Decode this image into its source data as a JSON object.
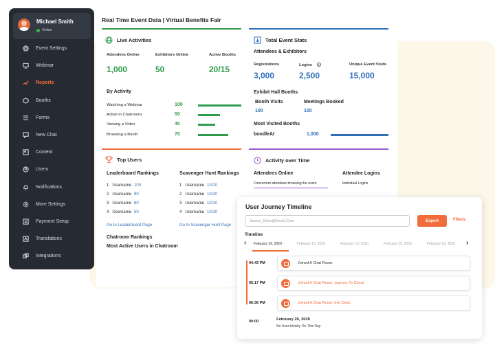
{
  "sidebar": {
    "user_name": "Michael Smith",
    "user_status": "Online",
    "items": [
      {
        "label": "Event Settings",
        "icon": "gear-icon"
      },
      {
        "label": "Webinar",
        "icon": "monitor-icon"
      },
      {
        "label": "Reports",
        "icon": "chart-icon"
      },
      {
        "label": "Booths",
        "icon": "booth-icon"
      },
      {
        "label": "Forms",
        "icon": "forms-icon"
      },
      {
        "label": "New Chat",
        "icon": "chat-icon"
      },
      {
        "label": "Content",
        "icon": "content-icon"
      },
      {
        "label": "Users",
        "icon": "users-icon"
      },
      {
        "label": "Notifications",
        "icon": "bell-icon"
      },
      {
        "label": "More Settings",
        "icon": "settings-icon"
      },
      {
        "label": "Payment Setup",
        "icon": "payment-icon"
      },
      {
        "label": "Translations",
        "icon": "translate-icon"
      },
      {
        "label": "Integrations",
        "icon": "integrations-icon"
      }
    ],
    "active_item": "Reports",
    "colors": {
      "bg": "#262b33",
      "active": "#f26b3a"
    }
  },
  "main": {
    "title": "Real Time Event Data | Virtual Benefits Fair",
    "live_activities": {
      "title": "Live Activities",
      "labels": [
        "Attendees Online",
        "Exhibitors Online",
        "Active Booths"
      ],
      "values": [
        "1,000",
        "50",
        "20/15"
      ]
    },
    "by_activity": {
      "title": "By Activity",
      "rows": [
        {
          "label": "Watching a Webinar",
          "value": "100",
          "level": 1.0
        },
        {
          "label": "Active in Chatrooms",
          "value": "50",
          "level": 0.5
        },
        {
          "label": "Viewing a Video",
          "value": "40",
          "level": 0.4
        },
        {
          "label": "Browsing a Booth",
          "value": "70",
          "level": 0.7
        }
      ]
    },
    "top_users": {
      "title": "Top Users",
      "leaderboard_title": "Leaderboard Rankings",
      "scavenger_title": "Scavenger Hunt Rankings",
      "leaderboard": [
        {
          "rank": "1",
          "name": "Username",
          "score": "100"
        },
        {
          "rank": "2",
          "name": "Username",
          "score": "80"
        },
        {
          "rank": "3",
          "name": "Username",
          "score": "60"
        },
        {
          "rank": "4",
          "name": "Username",
          "score": "50"
        }
      ],
      "scavenger": [
        {
          "rank": "1",
          "name": "Username",
          "score": "10/10"
        },
        {
          "rank": "2",
          "name": "Username",
          "score": "10/10"
        },
        {
          "rank": "3",
          "name": "Username",
          "score": "10/10"
        },
        {
          "rank": "4",
          "name": "Username",
          "score": "10/10"
        }
      ],
      "leaderboard_link": "Go to Leaderboard Page",
      "scavenger_link": "Go to Scavenger Hunt Page",
      "chatroom_title": "Chatroom Rankings",
      "chatroom_sub": "Most Active Users in Chatroom"
    },
    "total_stats": {
      "title": "Total Event Stats",
      "subtitle": "Attendees & Exhibitors",
      "labels": [
        "Registrations",
        "Logins",
        "Unique Event Visits"
      ],
      "values": [
        "3,000",
        "2,500",
        "15,000"
      ],
      "exhibit_title": "Exhibit Hall Booths",
      "booth_visits_label": "Booth Visits",
      "meetings_label": "Meetings Booked",
      "booth_visits_value": "100",
      "meetings_value": "100",
      "most_visited_title": "Most Visited Booths",
      "most_visited_name": "boodleAI",
      "most_visited_value": "1,000",
      "most_visited_level": 1.0
    },
    "activity_over_time": {
      "title": "Activity over Time",
      "attendees_online": "Attendees Online",
      "attendees_online_sub": "Concurrent attendees browsing the event",
      "attendee_logins": "Attendee Logins",
      "attendee_logins_sub": "Individual Logins"
    }
  },
  "timeline": {
    "title": "User Journey Timeline",
    "search_placeholder": "James_Debo@Email.Com",
    "export_label": "Export",
    "filters_label": "Filters",
    "subtitle": "Timeline",
    "dates": [
      "February 19, 2020",
      "February 19, 2020",
      "February 19, 2020",
      "February 19, 2020",
      "February 19, 2020"
    ],
    "events": [
      {
        "time": "04:43 PM",
        "text": "Joined A Chat Room.",
        "highlight": false
      },
      {
        "time": "05:17 PM",
        "text": "Joined A Chat Room: Journey To Cloud",
        "highlight": true
      },
      {
        "time": "06:36 PM",
        "text": "Joined A Chat Room: Info Desk",
        "highlight": true
      }
    ],
    "empty_time": "00:00",
    "empty_date": "February 20, 2020",
    "empty_text": "No User Activity On This Day"
  }
}
